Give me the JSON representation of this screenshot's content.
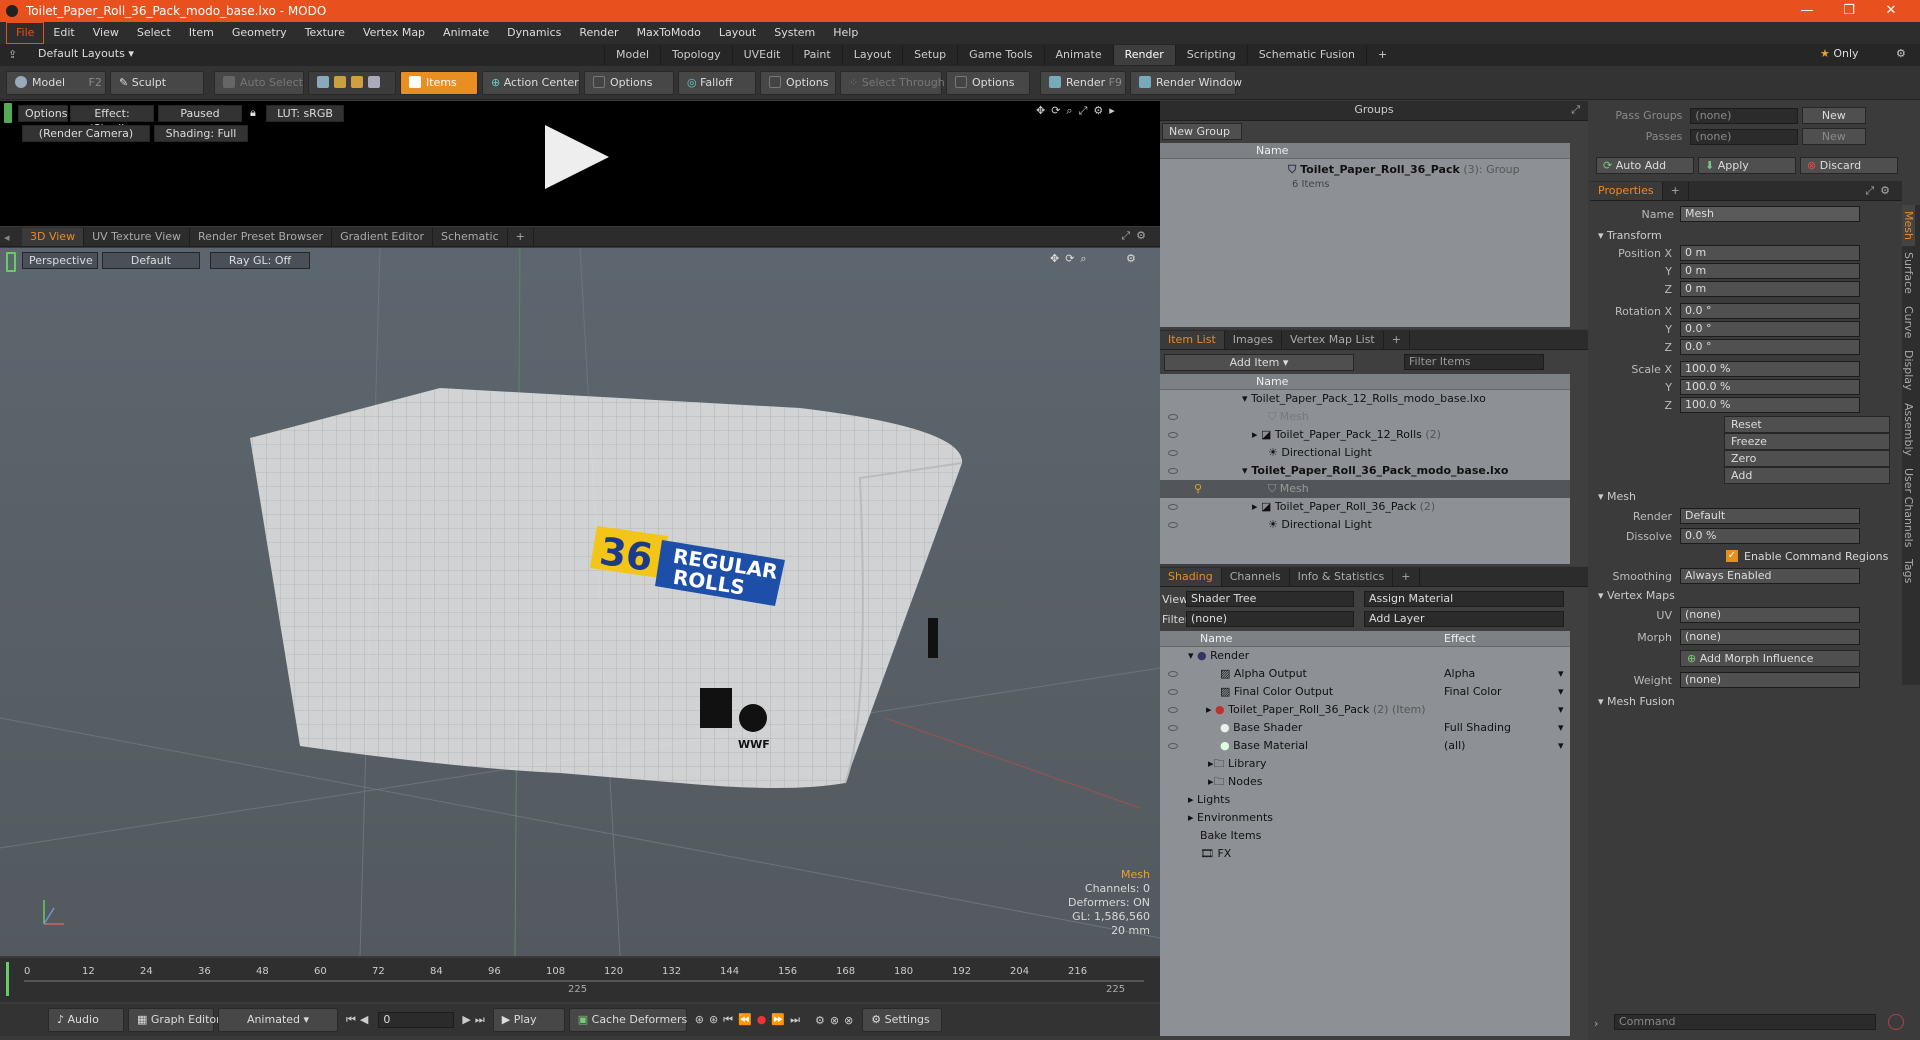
{
  "app": {
    "title": "Toilet_Paper_Roll_36_Pack_modo_base.lxo - MODO"
  },
  "menus": [
    "File",
    "Edit",
    "View",
    "Select",
    "Item",
    "Geometry",
    "Texture",
    "Vertex Map",
    "Animate",
    "Dynamics",
    "Render",
    "MaxToModo",
    "Layout",
    "System",
    "Help"
  ],
  "layouts": {
    "default": "Default Layouts",
    "tabs": [
      "Model",
      "Topology",
      "UVEdit",
      "Paint",
      "Layout",
      "Setup",
      "Game Tools",
      "Animate",
      "Render",
      "Scripting",
      "Schematic Fusion"
    ],
    "active": "Render",
    "only": "Only"
  },
  "toolbar": {
    "model": "Model",
    "model_key": "F2",
    "sculpt": "Sculpt",
    "auto_select": "Auto Select",
    "items": "Items",
    "action_center": "Action Center",
    "options1": "Options",
    "falloff": "Falloff",
    "options2": "Options",
    "select_through": "Select Through",
    "options3": "Options",
    "render": "Render",
    "render_key": "F9",
    "render_window": "Render Window"
  },
  "preview": {
    "options": "Options",
    "effect": "Effect: (Shadi...",
    "paused": "Paused",
    "lut": "LUT: sRGB",
    "camera": "(Render Camera)",
    "shading": "Shading: Full"
  },
  "viewtabs": [
    "3D View",
    "UV Texture View",
    "Render Preset Browser",
    "Gradient Editor",
    "Schematic"
  ],
  "viewport": {
    "perspective": "Perspective",
    "default": "Default",
    "raygl": "Ray GL: Off",
    "stats": {
      "mesh": "Mesh",
      "channels": "Channels: 0",
      "deformers": "Deformers: ON",
      "gl": "GL: 1,586,560",
      "size": "20 mm"
    }
  },
  "package": {
    "number": "36",
    "line1": "REGULAR",
    "line2": "ROLLS",
    "wwf": "WWF"
  },
  "groups": {
    "title": "Groups",
    "new_group": "New Group",
    "name_col": "Name",
    "item": "Toilet_Paper_Roll_36_Pack",
    "count": "(3)",
    "kind": ": Group",
    "items": "6 Items"
  },
  "itemlist": {
    "tabs": [
      "Item List",
      "Images",
      "Vertex Map List"
    ],
    "add_item": "Add Item",
    "filter": "Filter Items",
    "name_col": "Name",
    "rows": [
      {
        "t": "Toilet_Paper_Pack_12_Rolls_modo_base.lxo",
        "s": ""
      },
      {
        "t": "Mesh",
        "s": ""
      },
      {
        "t": "Toilet_Paper_Pack_12_Rolls",
        "s": "(2)"
      },
      {
        "t": "Directional Light",
        "s": ""
      },
      {
        "t": "Toilet_Paper_Roll_36_Pack_modo_base.lxo",
        "s": ""
      },
      {
        "t": "Mesh",
        "s": ""
      },
      {
        "t": "Toilet_Paper_Roll_36_Pack",
        "s": "(2)"
      },
      {
        "t": "Directional Light",
        "s": ""
      }
    ]
  },
  "shading": {
    "tabs": [
      "Shading",
      "Channels",
      "Info & Statistics"
    ],
    "view_label": "View",
    "view": "Shader Tree",
    "assign": "Assign Material",
    "filter_label": "Filter",
    "filter": "(none)",
    "add_layer": "Add Layer",
    "name_col": "Name",
    "effect_col": "Effect",
    "rows": [
      {
        "t": "Render",
        "e": ""
      },
      {
        "t": "Alpha Output",
        "e": "Alpha"
      },
      {
        "t": "Final Color Output",
        "e": "Final Color"
      },
      {
        "t": "Toilet_Paper_Roll_36_Pack",
        "s": "(2) (Item)",
        "e": ""
      },
      {
        "t": "Base Shader",
        "e": "Full Shading"
      },
      {
        "t": "Base Material",
        "e": "(all)"
      },
      {
        "t": "Library",
        "e": ""
      },
      {
        "t": "Nodes",
        "e": ""
      },
      {
        "t": "Lights",
        "e": ""
      },
      {
        "t": "Environments",
        "e": ""
      },
      {
        "t": "Bake Items",
        "e": ""
      },
      {
        "t": "FX",
        "e": ""
      }
    ]
  },
  "props": {
    "pass_groups": "Pass Groups",
    "passes": "Passes",
    "none": "(none)",
    "new": "New",
    "auto_add": "Auto Add",
    "apply": "Apply",
    "discard": "Discard",
    "properties": "Properties",
    "name_label": "Name",
    "name": "Mesh",
    "transform": "Transform",
    "pos_label": "Position X",
    "rot_label": "Rotation X",
    "scale_label": "Scale X",
    "y": "Y",
    "z": "Z",
    "pos": "0 m",
    "rot": "0.0 °",
    "scale": "100.0 %",
    "reset": "Reset",
    "freeze": "Freeze",
    "zero": "Zero",
    "add": "Add",
    "mesh": "Mesh",
    "render_label": "Render",
    "render": "Default",
    "dissolve_label": "Dissolve",
    "dissolve": "0.0 %",
    "cmd_regions": "Enable Command Regions",
    "smoothing_label": "Smoothing",
    "smoothing": "Always Enabled",
    "vertex_maps": "Vertex Maps",
    "uv_label": "UV",
    "morph_label": "Morph",
    "add_morph": "Add Morph Influence",
    "weight_label": "Weight",
    "mesh_fusion": "Mesh Fusion",
    "side_tabs": [
      "Mesh",
      "Surface",
      "Curve",
      "Display",
      "Assembly",
      "User Channels",
      "Tags"
    ]
  },
  "timeline": {
    "ticks": [
      "0",
      "12",
      "24",
      "36",
      "48",
      "60",
      "72",
      "84",
      "96",
      "108",
      "120",
      "132",
      "144",
      "156",
      "168",
      "180",
      "192",
      "204",
      "216"
    ],
    "sub1": "225",
    "sub2": "225"
  },
  "bottom": {
    "audio": "Audio",
    "graph": "Graph Editor",
    "animated": "Animated",
    "frame": "0",
    "play": "Play",
    "cache": "Cache Deformers",
    "settings": "Settings",
    "command": "Command"
  }
}
